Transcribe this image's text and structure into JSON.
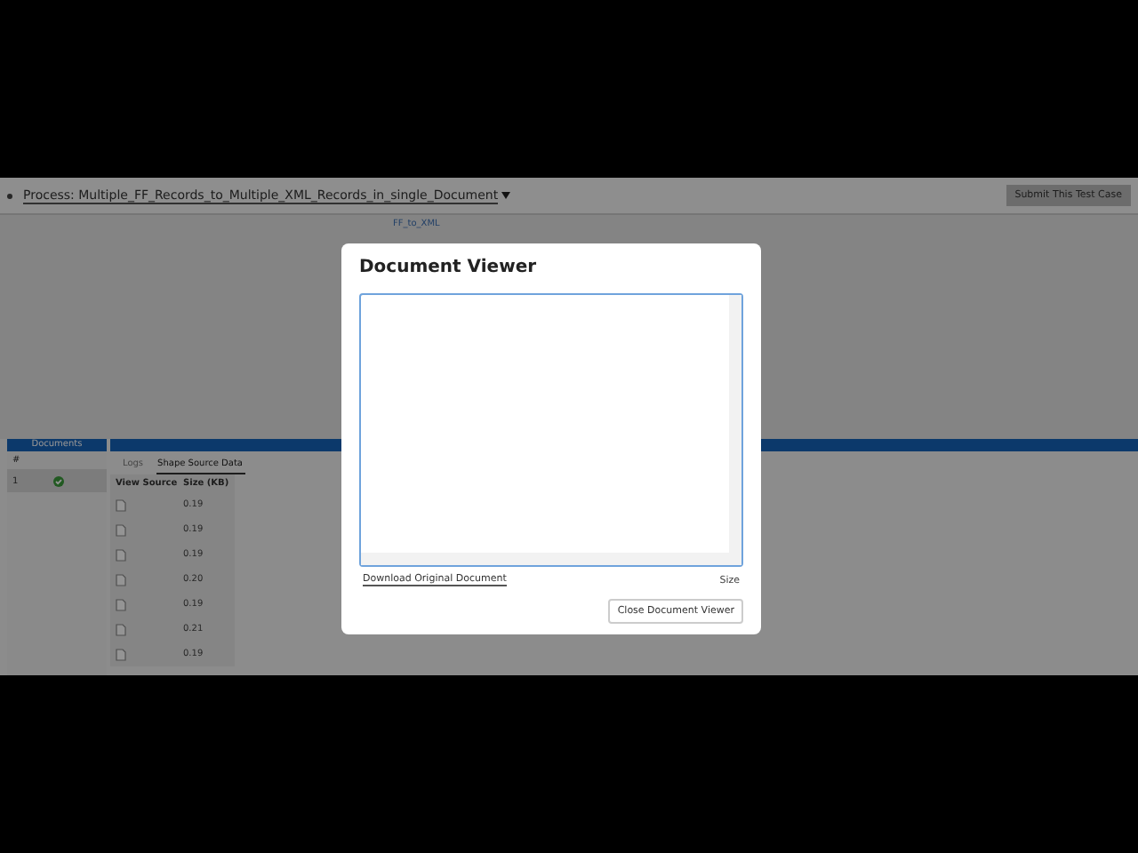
{
  "header": {
    "process_label": "Process: Multiple_FF_Records_to_Multiple_XML_Records_in_single_Document",
    "submit_button": "Submit This Test Case"
  },
  "canvas": {
    "shape_label": "FF_to_XML"
  },
  "documents": {
    "title": "Documents",
    "column": "#",
    "rows": [
      {
        "number": "1",
        "succeeded": true,
        "selected": true
      }
    ]
  },
  "tabs": [
    {
      "label": "Logs",
      "selected": false
    },
    {
      "label": "Shape Source Data",
      "selected": true
    }
  ],
  "table": {
    "columns": [
      "View Source",
      "Size (KB)"
    ],
    "rows": [
      {
        "size": "0.19"
      },
      {
        "size": "0.19"
      },
      {
        "size": "0.19"
      },
      {
        "size": "0.20"
      },
      {
        "size": "0.19"
      },
      {
        "size": "0.21"
      },
      {
        "size": "0.19"
      }
    ]
  },
  "dialog": {
    "title": "Document Viewer",
    "download_link": "Download Original Document",
    "size_label": "Size",
    "close_button": "Close Document Viewer"
  }
}
